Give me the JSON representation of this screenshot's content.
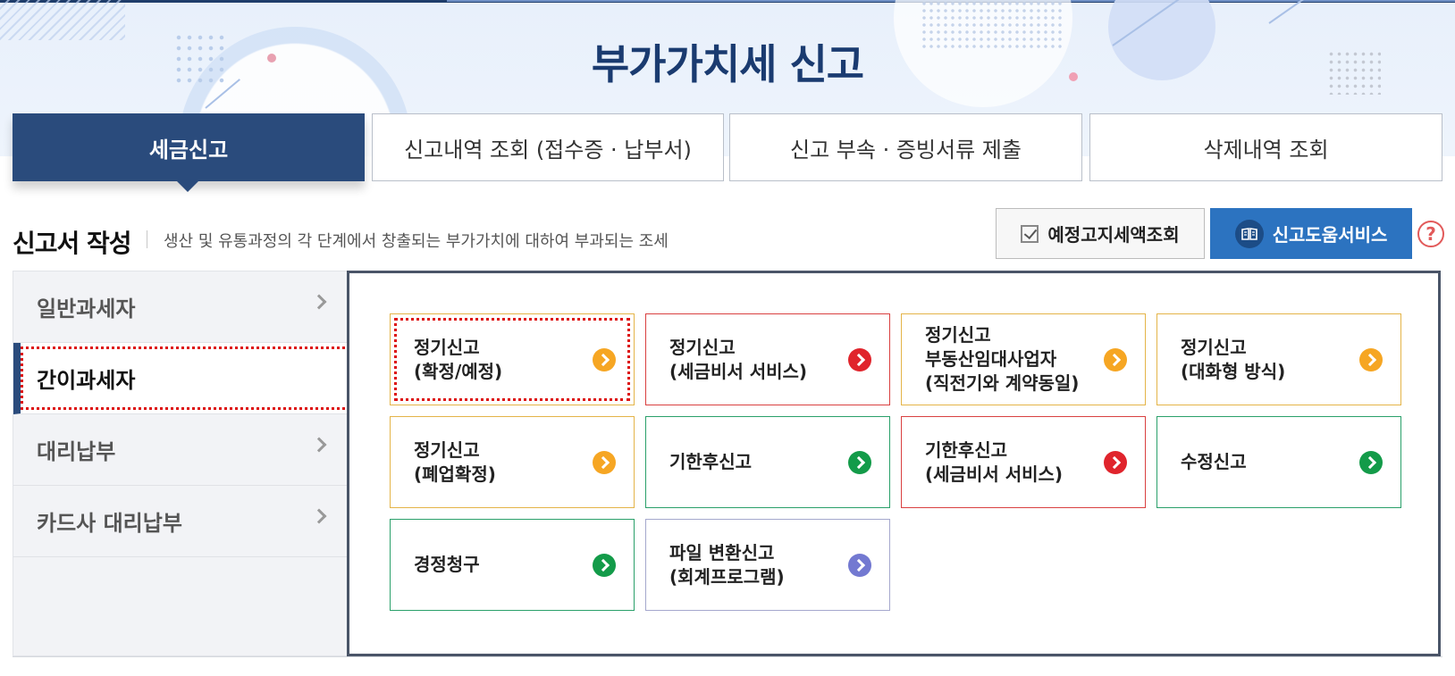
{
  "header": {
    "title": "부가가치세 신고"
  },
  "tabs": [
    {
      "label": "세금신고",
      "active": true
    },
    {
      "label": "신고내역 조회 (접수증 · 납부서)",
      "active": false
    },
    {
      "label": "신고 부속 · 증빙서류 제출",
      "active": false
    },
    {
      "label": "삭제내역 조회",
      "active": false
    }
  ],
  "section": {
    "title": "신고서 작성",
    "description": "생산 및 유통과정의 각 단계에서 창출되는 부가가치에 대하여 부과되는 조세",
    "predict_button": "예정고지세액조회",
    "help_button": "신고도움서비스",
    "help_icon": "?"
  },
  "sidemenu": {
    "items": [
      {
        "label": "일반과세자",
        "active": false
      },
      {
        "label": "간이과세자",
        "active": true
      },
      {
        "label": "대리납부",
        "active": false
      },
      {
        "label": "카드사 대리납부",
        "active": false
      }
    ]
  },
  "cards": [
    {
      "label": "정기신고\n(확정/예정)",
      "color": "orange",
      "highlighted": true
    },
    {
      "label": "정기신고\n(세금비서 서비스)",
      "color": "red"
    },
    {
      "label": "정기신고\n부동산임대사업자\n(직전기와 계약동일)",
      "color": "orange"
    },
    {
      "label": "정기신고\n(대화형 방식)",
      "color": "orange"
    },
    {
      "label": "정기신고\n(폐업확정)",
      "color": "orange"
    },
    {
      "label": "기한후신고",
      "color": "green"
    },
    {
      "label": "기한후신고\n(세금비서 서비스)",
      "color": "red"
    },
    {
      "label": "수정신고",
      "color": "green"
    },
    {
      "label": "경정청구",
      "color": "green"
    },
    {
      "label": "파일 변환신고\n(회계프로그램)",
      "color": "purple"
    }
  ],
  "colors": {
    "primary": "#2a4b7c",
    "help_blue": "#2c73c0",
    "orange": "#f6a623",
    "red": "#e0242c",
    "green": "#139b49",
    "purple": "#7379d1"
  }
}
